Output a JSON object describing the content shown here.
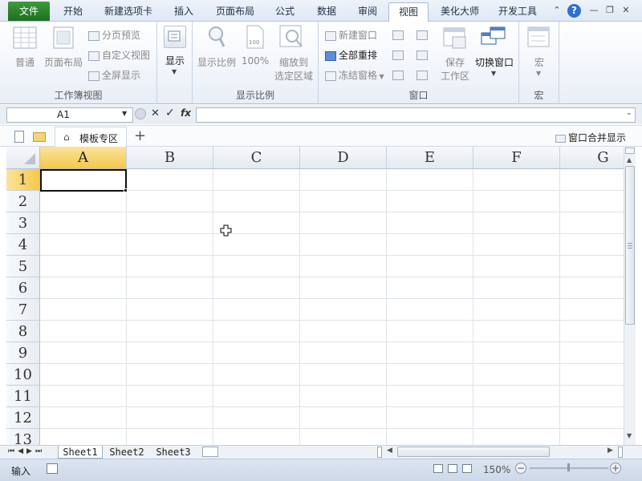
{
  "menu": {
    "file": "文件",
    "tabs": [
      "开始",
      "新建选项卡",
      "插入",
      "页面布局",
      "公式",
      "数据",
      "审阅",
      "视图",
      "美化大师",
      "开发工具"
    ],
    "active_tab": "视图"
  },
  "ribbon": {
    "group1": {
      "label": "工作簿视图",
      "normal": "普通",
      "page_layout": "页面布局",
      "page_break": "分页预览",
      "custom_view": "自定义视图",
      "full_screen": "全屏显示"
    },
    "group2": {
      "show": "显示"
    },
    "group3": {
      "label": "显示比例",
      "zoom": "显示比例",
      "hundred": "100%",
      "zoom_selection_1": "缩放到",
      "zoom_selection_2": "选定区域"
    },
    "group4": {
      "label": "窗口",
      "new_window": "新建窗口",
      "arrange_all": "全部重排",
      "freeze": "冻结窗格",
      "save_ws_1": "保存",
      "save_ws_2": "工作区",
      "switch": "切换窗口"
    },
    "group5": {
      "label": "宏",
      "macros": "宏"
    }
  },
  "formula_bar": {
    "name_box": "A1",
    "fx": "fx",
    "value": ""
  },
  "tabbar": {
    "template_tab": "模板专区",
    "plus": "+",
    "merge": "窗口合并显示"
  },
  "grid": {
    "columns": [
      "A",
      "B",
      "C",
      "D",
      "E",
      "F",
      "G"
    ],
    "rows": [
      "1",
      "2",
      "3",
      "4",
      "5",
      "6",
      "7",
      "8",
      "9",
      "10",
      "11",
      "12",
      "13"
    ],
    "selected_cell": "A1"
  },
  "sheets": [
    "Sheet1",
    "Sheet2",
    "Sheet3"
  ],
  "status": {
    "mode": "输入",
    "zoom": "150%"
  },
  "colors": {
    "accent": "#1d6f1d",
    "selected_header": "#f5c84c"
  }
}
